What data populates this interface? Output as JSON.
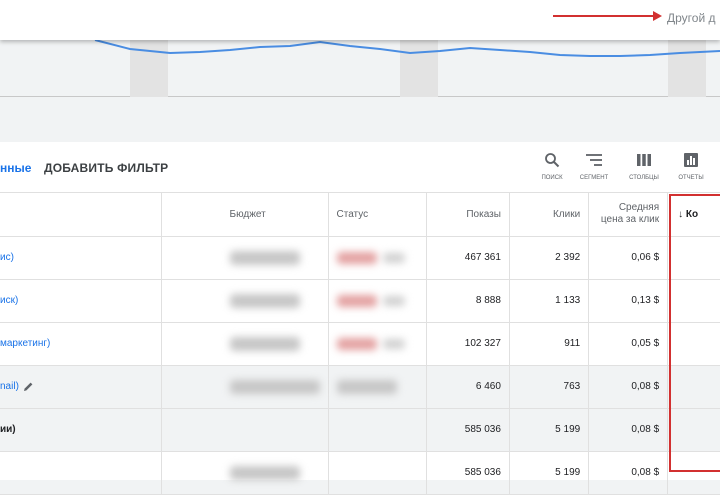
{
  "header": {
    "other_date_label": "Другой д",
    "arrow_color": "#d23030"
  },
  "chart": {
    "line_color": "#4a8de2"
  },
  "toolbar": {
    "filter_link": "нные",
    "add_filter": "ДОБАВИТЬ ФИЛЬТР",
    "search": {
      "icon": "search-icon",
      "label": "ПОИСК"
    },
    "segment": {
      "icon": "segment-icon",
      "label": "СЕГМЕНТ"
    },
    "columns": {
      "icon": "columns-icon",
      "label": "СТОЛБЦЫ"
    },
    "reports": {
      "icon": "reports-icon",
      "label": "ОТЧЕТЫ"
    }
  },
  "table": {
    "headers": {
      "campaign": "",
      "budget": "Бюджет",
      "status": "Статус",
      "impressions": "Показы",
      "clicks": "Клики",
      "avg_cpc": "Средняя цена за клик",
      "conversions": "↓ Ко"
    },
    "rows": [
      {
        "campaign": "ис)",
        "impressions": "467 361",
        "clicks": "2 392",
        "avg_cpc": "0,06 $"
      },
      {
        "campaign": "иск)",
        "impressions": "8 888",
        "clicks": "1 133",
        "avg_cpc": "0,13 $"
      },
      {
        "campaign": "маркетинг)",
        "impressions": "102 327",
        "clicks": "911",
        "avg_cpc": "0,05 $"
      },
      {
        "campaign": "nail)",
        "impressions": "6 460",
        "clicks": "763",
        "avg_cpc": "0,08 $"
      },
      {
        "campaign": "ии)",
        "impressions": "585 036",
        "clicks": "5 199",
        "avg_cpc": "0,08 $"
      },
      {
        "campaign": "",
        "impressions": "585 036",
        "clicks": "5 199",
        "avg_cpc": "0,08 $"
      }
    ]
  },
  "colors": {
    "link_blue": "#1a73e8",
    "highlight_red": "#d23030"
  }
}
